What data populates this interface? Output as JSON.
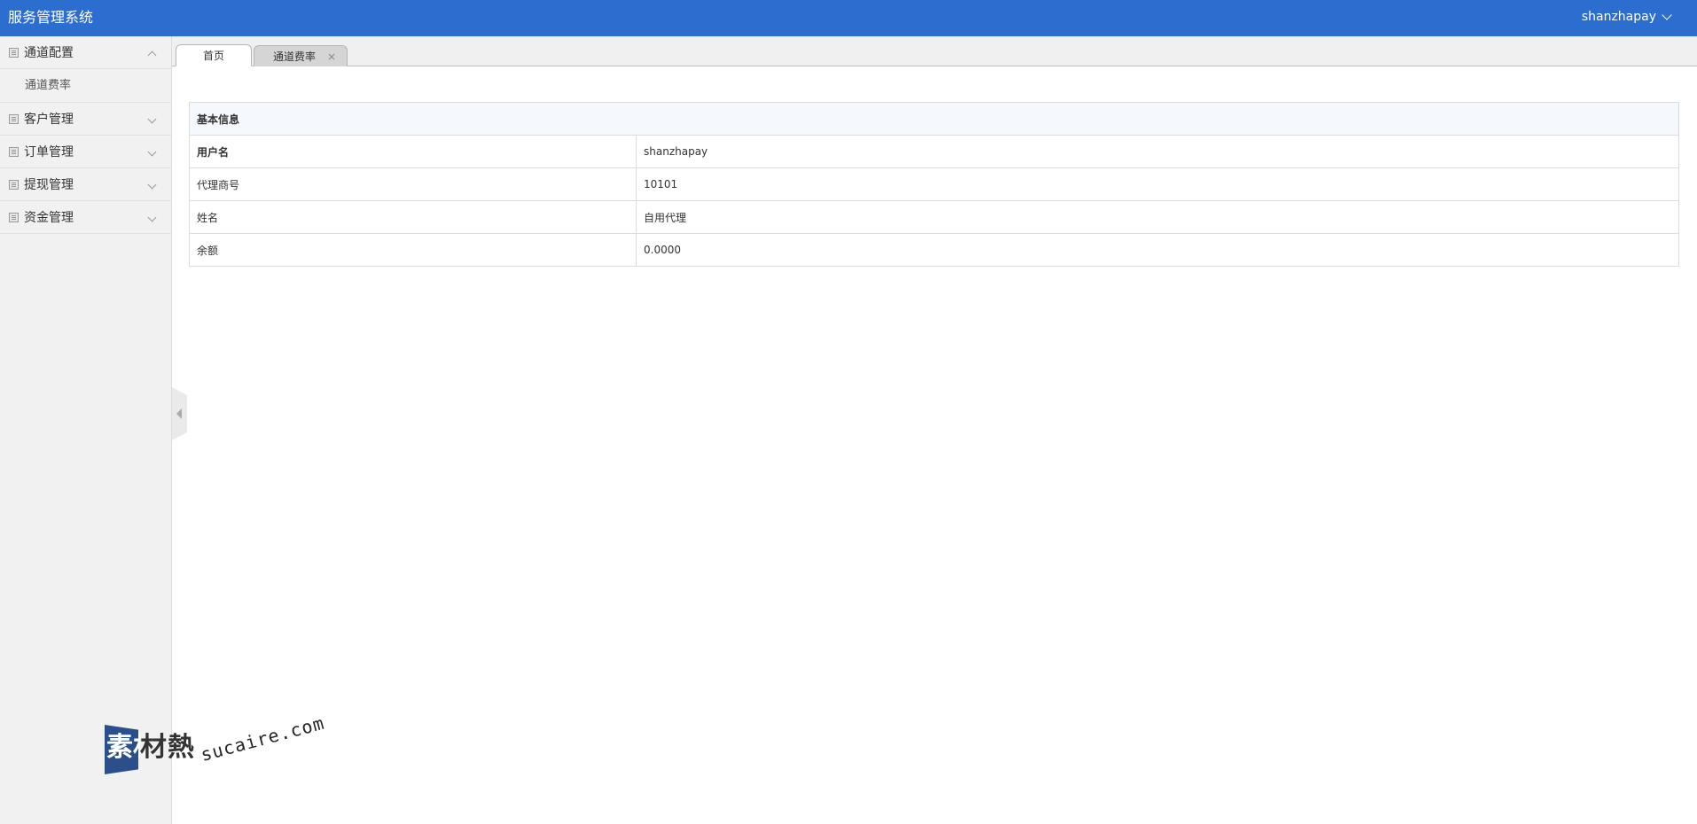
{
  "header": {
    "title": "服务管理系统",
    "username": "shanzhapay"
  },
  "sidebar": {
    "groups": [
      {
        "label": "通道配置",
        "expanded": true,
        "items": [
          "通道费率"
        ]
      },
      {
        "label": "客户管理",
        "expanded": false
      },
      {
        "label": "订单管理",
        "expanded": false
      },
      {
        "label": "提现管理",
        "expanded": false
      },
      {
        "label": "资金管理",
        "expanded": false
      }
    ]
  },
  "tabs": [
    {
      "label": "首页",
      "active": true
    },
    {
      "label": "通道费率",
      "active": false,
      "close": "×"
    }
  ],
  "info_table": {
    "heading": "基本信息",
    "rows": [
      {
        "key": "用户名",
        "value": "shanzhapay"
      },
      {
        "key": "代理商号",
        "value": "10101"
      },
      {
        "key": "姓名",
        "value": "自用代理"
      },
      {
        "key": "余额",
        "value": "0.0000"
      }
    ]
  },
  "watermark": {
    "brand": "素材熱",
    "url": "sucaire.com"
  },
  "colors": {
    "header_bg": "#2b6ecf",
    "sidebar_bg": "#f1f1f1",
    "table_head_bg": "#f5f9fd"
  }
}
